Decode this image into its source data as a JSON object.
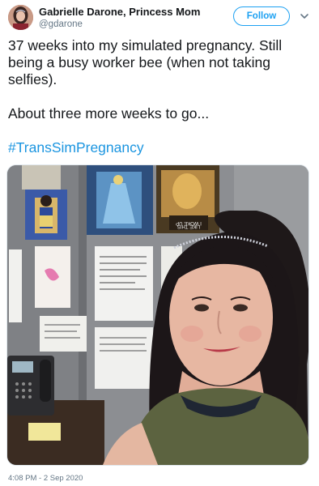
{
  "tweet": {
    "author": {
      "display_name": "Gabrielle Darone, Princess Mom",
      "handle": "@gdarone",
      "avatar_icon": "user-avatar"
    },
    "follow_label": "Follow",
    "menu_icon": "chevron-down-icon",
    "text": {
      "line1": "37 weeks into my simulated pregnancy.  Still being a busy worker bee (when not taking selfies).",
      "line2": "About three more weeks to go...",
      "hashtag": "#TransSimPregnancy"
    },
    "photo": {
      "poster_text_line1": "I WOKE UP",
      "poster_text_line2": "LIKE THIS"
    },
    "timestamp": "4:08 PM - 2 Sep 2020"
  },
  "colors": {
    "accent": "#1da1f2",
    "hashtag": "#1b95e0",
    "text": "#14171a",
    "muted": "#657786"
  }
}
